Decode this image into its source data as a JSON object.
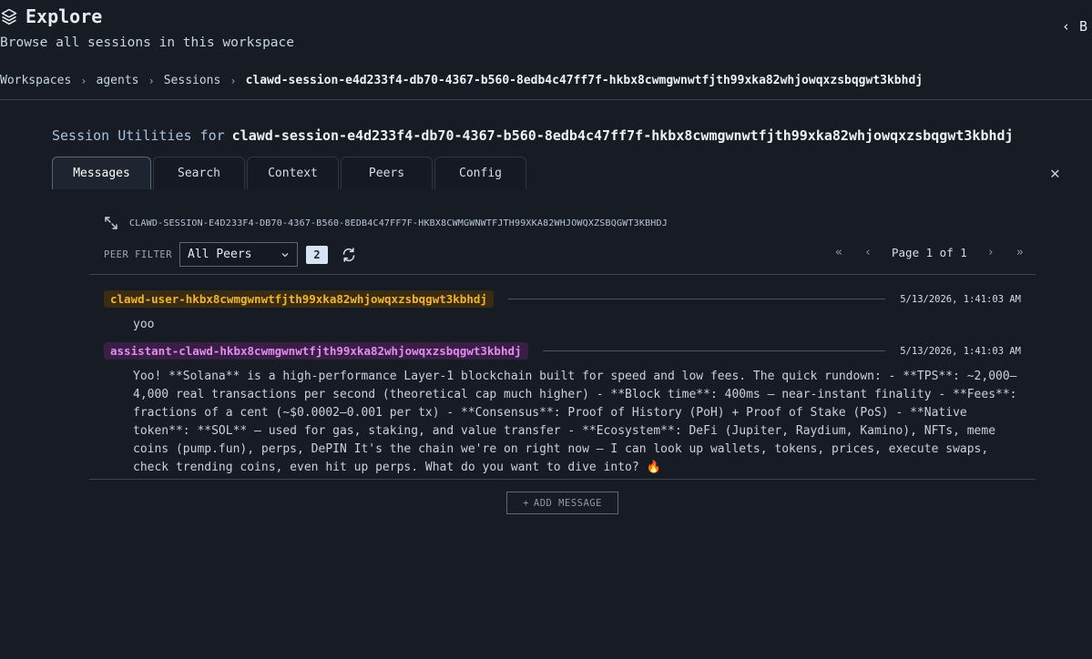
{
  "header": {
    "title": "Explore",
    "subtitle": "Browse all sessions in this workspace",
    "back_label": "B"
  },
  "breadcrumb": {
    "items": [
      "Workspaces",
      "agents",
      "Sessions",
      "clawd-session-e4d233f4-db70-4367-b560-8edb4c47ff7f-hkbx8cwmgwnwtfjth99xka82whjowqxzsbqgwt3kbhdj"
    ]
  },
  "utilities": {
    "label": "Session Utilities for",
    "session_name": "clawd-session-e4d233f4-db70-4367-b560-8edb4c47ff7f-hkbx8cwmgwnwtfjth99xka82whjowqxzsbqgwt3kbhdj"
  },
  "tabs": [
    {
      "label": "Messages",
      "active": true
    },
    {
      "label": "Search",
      "active": false
    },
    {
      "label": "Context",
      "active": false
    },
    {
      "label": "Peers",
      "active": false
    },
    {
      "label": "Config",
      "active": false
    }
  ],
  "session_id_upper": "CLAWD-SESSION-E4D233F4-DB70-4367-B560-8EDB4C47FF7F-HKBX8CWMGWNWTFJTH99XKA82WHJOWQXZSBQGWT3KBHDJ",
  "filter": {
    "label": "PEER FILTER",
    "selected": "All Peers",
    "count": "2"
  },
  "pager": {
    "text": "Page 1 of 1"
  },
  "messages": [
    {
      "peer": "clawd-user-hkbx8cwmgwnwtfjth99xka82whjowqxzsbqgwt3kbhdj",
      "time": "5/13/2026, 1:41:03 AM",
      "body": "yoo"
    },
    {
      "peer": "assistant-clawd-hkbx8cwmgwnwtfjth99xka82whjowqxzsbqgwt3kbhdj",
      "time": "5/13/2026, 1:41:03 AM",
      "body": "Yoo! **Solana** is a high-performance Layer-1 blockchain built for speed and low fees. The quick rundown: - **TPS**: ~2,000–4,000 real transactions per second (theoretical cap much higher) - **Block time**: 400ms — near-instant finality - **Fees**: fractions of a cent (~$0.0002–0.001 per tx) - **Consensus**: Proof of History (PoH) + Proof of Stake (PoS) - **Native token**: **SOL** — used for gas, staking, and value transfer - **Ecosystem**: DeFi (Jupiter, Raydium, Kamino), NFTs, meme coins (pump.fun), perps, DePIN It's the chain we're on right now — I can look up wallets, tokens, prices, execute swaps, check trending coins, even hit up perps. What do you want to dive into? 🔥"
    }
  ],
  "add_message_label": "ADD MESSAGE",
  "colors": {
    "background": "#161b24",
    "user_tag": "#f1b42f",
    "assistant_tag": "#e28cf0",
    "badge": "#d8e4f3"
  }
}
